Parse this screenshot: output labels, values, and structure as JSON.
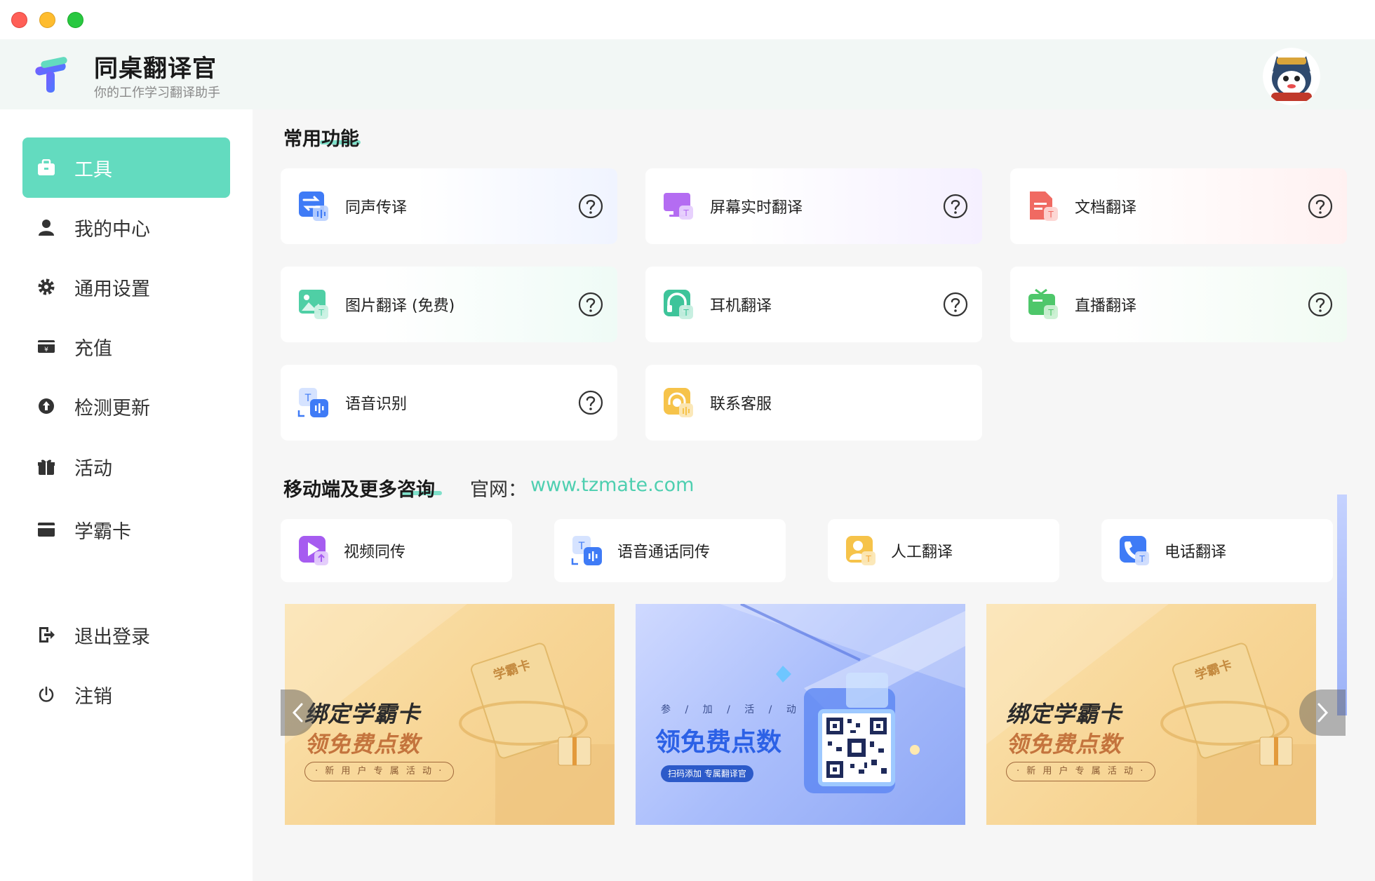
{
  "app": {
    "title": "同桌翻译官",
    "subtitle": "你的工作学习翻译助手",
    "brand_color": "#63dbbf"
  },
  "sidebar": {
    "items": [
      {
        "label": "工具",
        "icon": "briefcase-icon",
        "active": true
      },
      {
        "label": "我的中心",
        "icon": "user-icon"
      },
      {
        "label": "通用设置",
        "icon": "gear-icon"
      },
      {
        "label": "充值",
        "icon": "wallet-icon"
      },
      {
        "label": "检测更新",
        "icon": "upload-icon"
      },
      {
        "label": "活动",
        "icon": "gift-icon"
      },
      {
        "label": "学霸卡",
        "icon": "card-icon"
      }
    ],
    "bottom": [
      {
        "label": "退出登录",
        "icon": "logout-icon"
      },
      {
        "label": "注销",
        "icon": "power-icon"
      }
    ]
  },
  "common": {
    "title": "常用功能",
    "cards": [
      {
        "label": "同声传译",
        "icon": "interpret-icon"
      },
      {
        "label": "屏幕实时翻译",
        "icon": "screen-icon"
      },
      {
        "label": "文档翻译",
        "icon": "document-icon"
      },
      {
        "label": "图片翻译 (免费)",
        "icon": "image-icon"
      },
      {
        "label": "耳机翻译",
        "icon": "headphone-icon"
      },
      {
        "label": "直播翻译",
        "icon": "live-icon"
      },
      {
        "label": "语音识别",
        "icon": "voice-icon"
      },
      {
        "label": "联系客服",
        "icon": "service-icon"
      }
    ]
  },
  "mobile": {
    "title": "移动端及更多咨询",
    "site_label": "官网：",
    "site_url": "www.tzmate.com",
    "cards": [
      {
        "label": "视频同传",
        "icon": "video-icon"
      },
      {
        "label": "语音通话同传",
        "icon": "voice-call-icon"
      },
      {
        "label": "人工翻译",
        "icon": "human-icon"
      },
      {
        "label": "电话翻译",
        "icon": "phone-icon"
      }
    ]
  },
  "banners": [
    {
      "line1": "绑定学霸卡",
      "line2": "领免费点数",
      "pill": "· 新 用 户 专 属 活 动 ·",
      "tag": "学霸卡"
    },
    {
      "top": "参 / 加 / 活 / 动",
      "big": "领免费点数",
      "pill": "扫码添加  专属翻译官"
    },
    {
      "line1": "绑定学霸卡",
      "line2": "领免费点数",
      "pill": "· 新 用 户 专 属 活 动 ·",
      "tag": "学霸卡"
    }
  ]
}
